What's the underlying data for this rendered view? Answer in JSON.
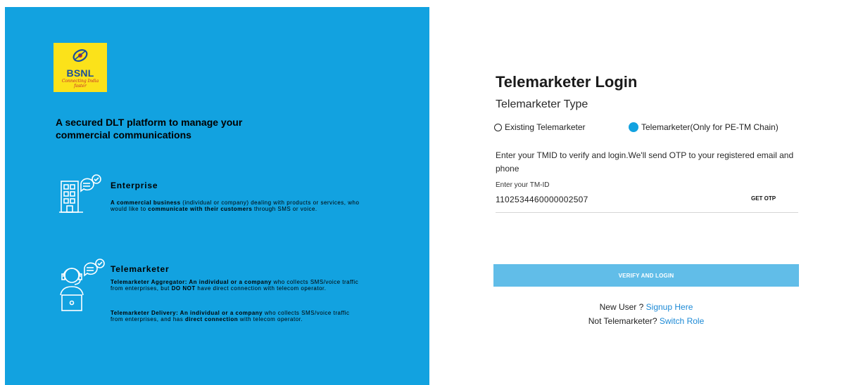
{
  "left_panel": {
    "logo": {
      "wordmark": "BSNL",
      "tagline_line1": "Connecting India",
      "tagline_line2": "faster"
    },
    "headline": "A secured DLT platform to manage your commercial communications",
    "enterprise": {
      "icon": "building-chat-icon",
      "title": "Enterprise",
      "desc_bold1": "A commercial business",
      "desc_text1": " (individual or company) dealing with products or services, who would like to ",
      "desc_bold2": "communicate with their customers",
      "desc_text2": " through SMS or voice."
    },
    "telemarketer": {
      "icon": "headset-agent-icon",
      "title": "Telemarketer",
      "agg_bold1": "Telemarketer Aggregator: An individual or a company",
      "agg_text1": " who collects SMS/voice traffic from enterprises, but ",
      "agg_bold2": "DO NOT",
      "agg_text2": " have direct connection with telecom operator.",
      "del_bold1": "Telemarketer Delivery: An individual or a company",
      "del_text1": " who collects SMS/voice traffic from enterprises, and has ",
      "del_bold2": "direct connection",
      "del_text2": " with telecom operator."
    }
  },
  "login": {
    "title": "Telemarketer Login",
    "type_label": "Telemarketer Type",
    "options": [
      {
        "label": "Existing Telemarketer",
        "selected": false
      },
      {
        "label": "Telemarketer(Only for PE-TM Chain)",
        "selected": true
      }
    ],
    "info": "Enter your TMID to verify and login.We'll send OTP to your registered email and phone",
    "tm_label": "Enter your TM-ID",
    "tm_value": "1102534460000002507",
    "get_otp": "GET OTP",
    "verify": "VERIFY AND LOGIN",
    "new_user_text": "New User ? ",
    "signup_link": "Signup Here",
    "not_tm_text": "Not Telemarketer? ",
    "switch_link": "Switch Role"
  },
  "colors": {
    "brand_blue": "#12a2e0",
    "button_blue": "#61bde8",
    "link_blue": "#1d8ad6",
    "logo_yellow": "#fbe21a"
  }
}
